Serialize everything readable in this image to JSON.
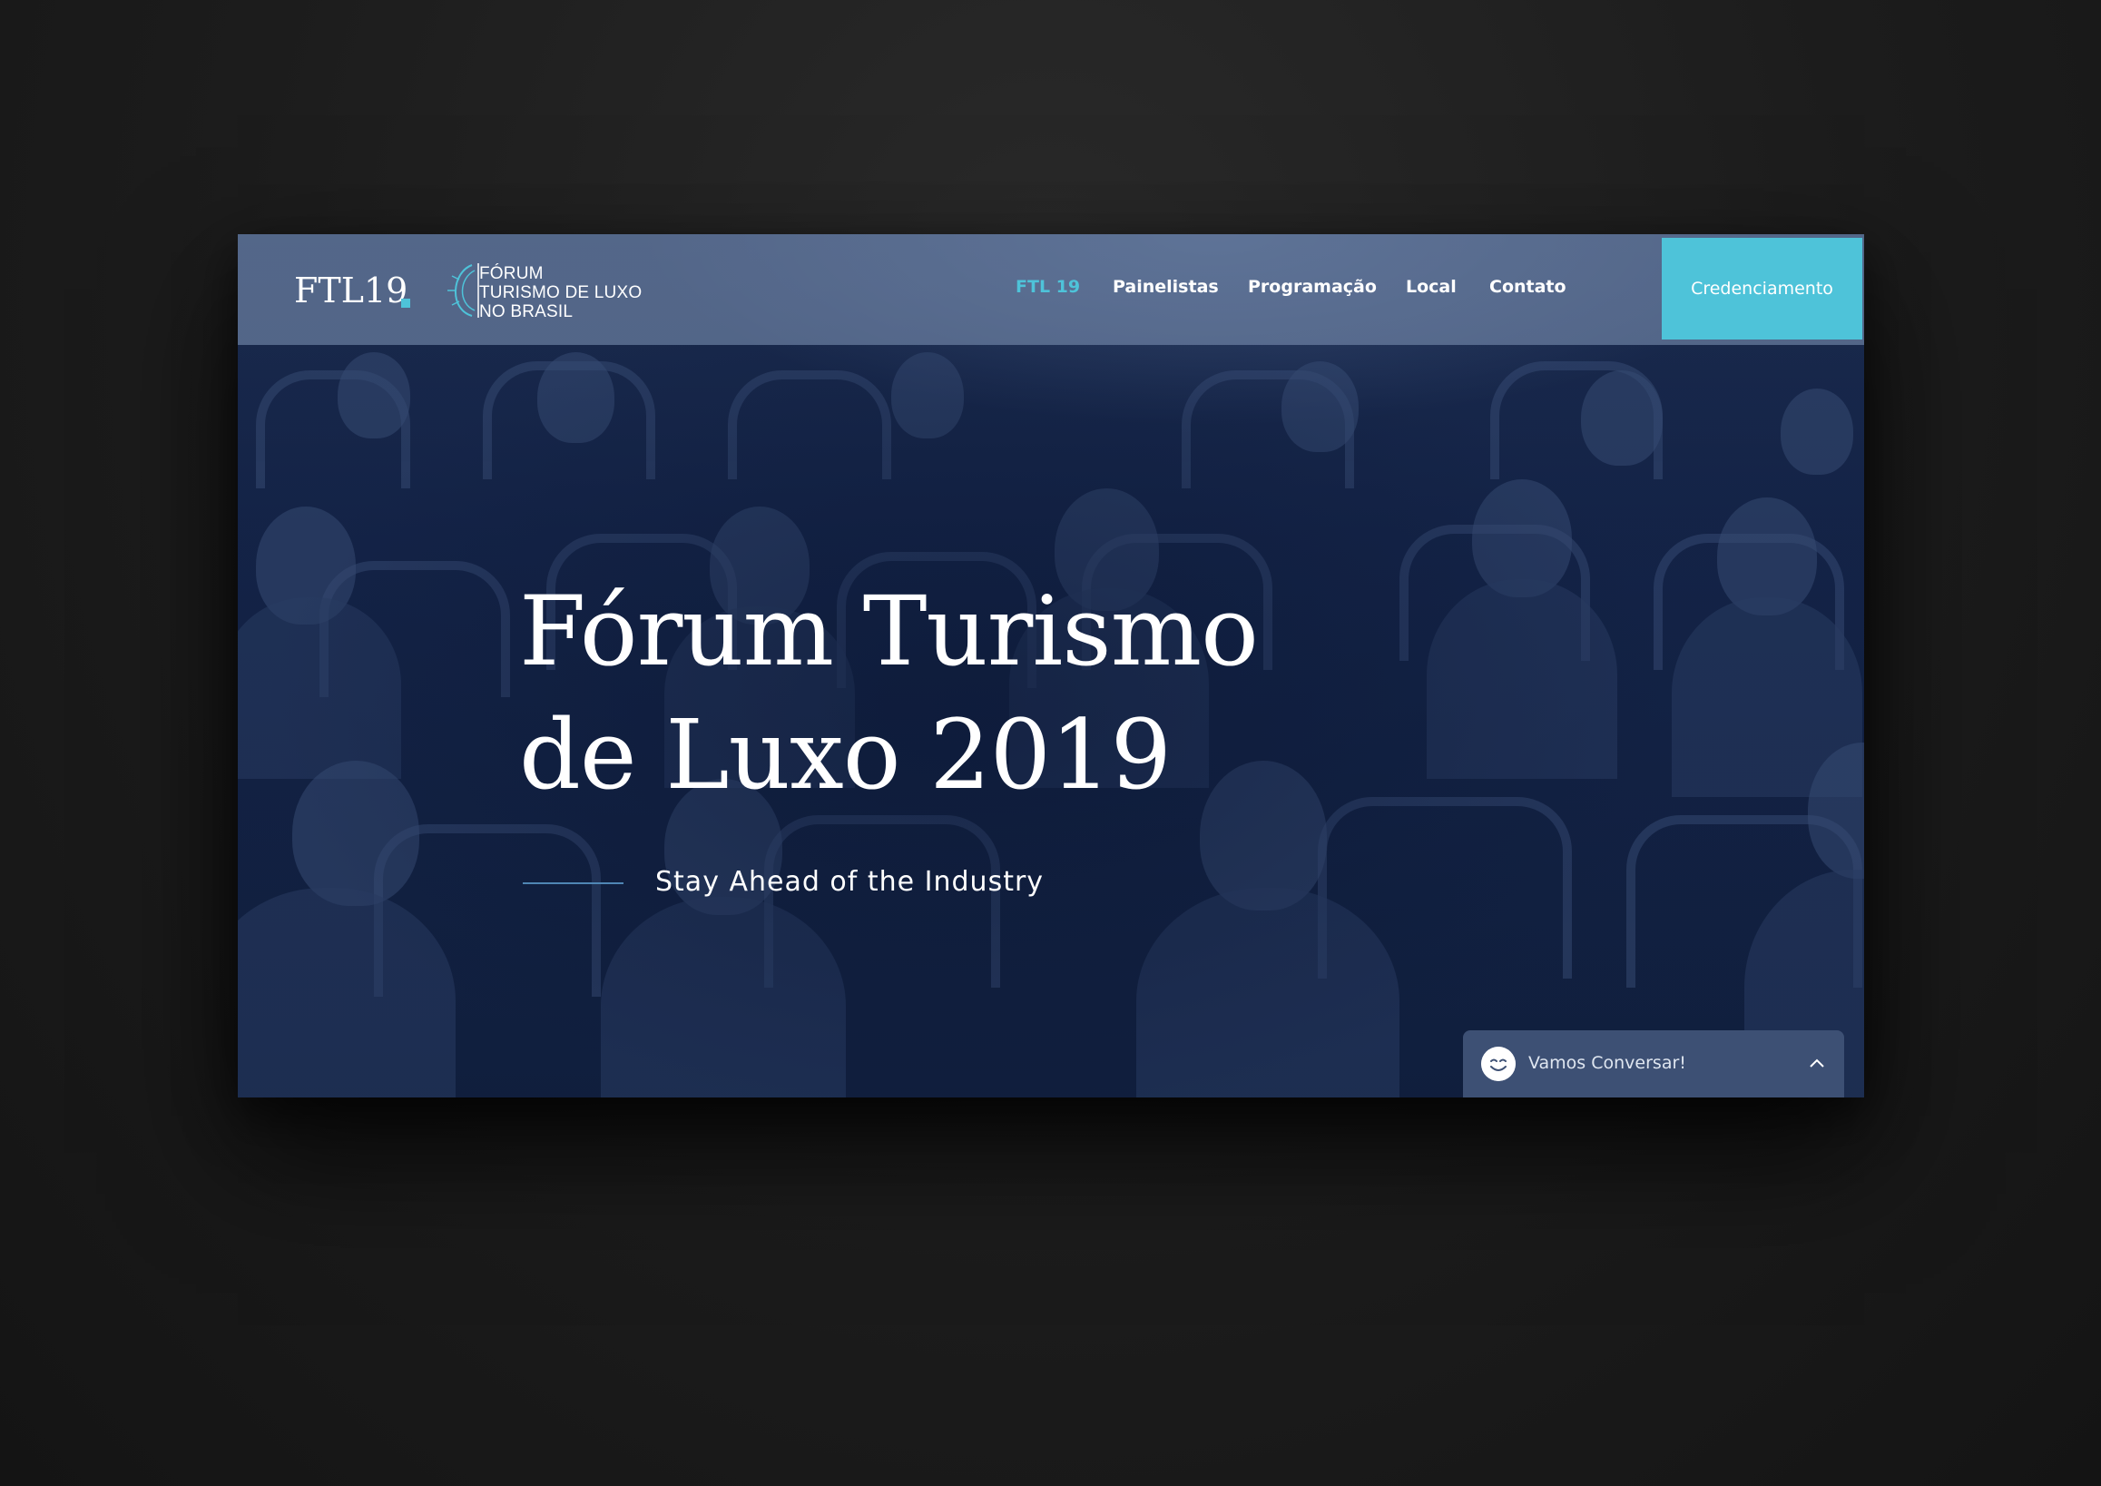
{
  "header": {
    "brand": "FTL19",
    "logo_lines": [
      "FÓRUM",
      "TURISMO DE LUXO",
      "NO BRASIL"
    ],
    "nav": [
      {
        "label": "FTL 19",
        "active": true
      },
      {
        "label": "Painelistas",
        "active": false
      },
      {
        "label": "Programação",
        "active": false
      },
      {
        "label": "Local",
        "active": false
      },
      {
        "label": "Contato",
        "active": false
      }
    ],
    "cta_label": "Credenciamento"
  },
  "hero": {
    "title_line1": "Fórum Turismo",
    "title_line2": "de Luxo 2019",
    "subtitle": "Stay Ahead of the Industry"
  },
  "chat": {
    "label": "Vamos Conversar!",
    "icon": "smiley-icon",
    "toggle_icon": "chevron-up-icon"
  },
  "colors": {
    "accent": "#4ec3d9",
    "hero_bg": "#12203d",
    "header_bg": "#788cafa0",
    "chat_bg": "#3d5074",
    "page_bg": "#1c1c1c"
  }
}
